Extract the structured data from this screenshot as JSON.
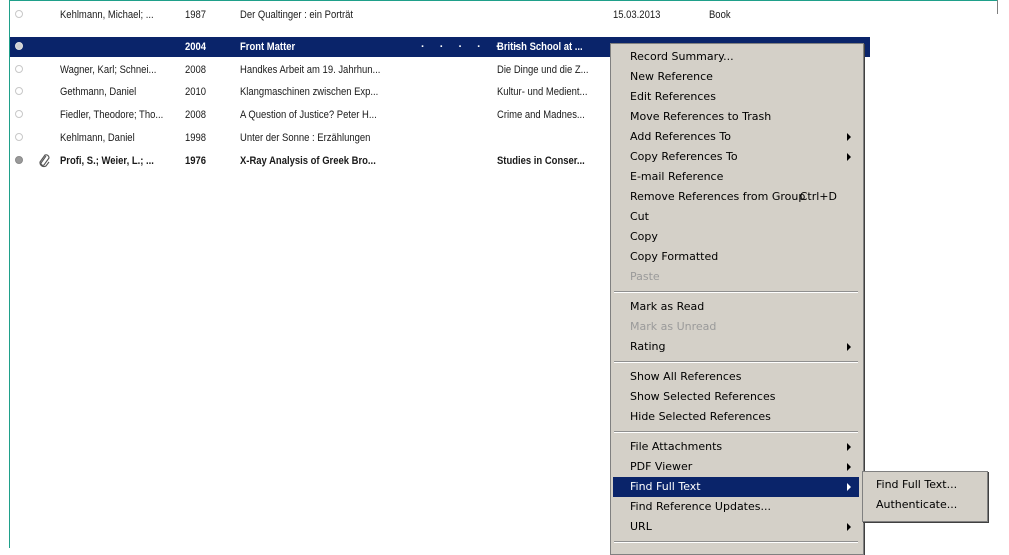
{
  "rows": [
    {
      "read": false,
      "attachment": false,
      "author": "Kehlmann, Michael; ...",
      "year": "1987",
      "title": "Der Qualtinger : ein Porträt",
      "secondary": "",
      "date": "15.03.2013",
      "type": "Book",
      "selected": false,
      "bold": false
    },
    {
      "read": true,
      "attachment": false,
      "author": "",
      "year": "2004",
      "title": "Front Matter",
      "secondary": "British School at ...",
      "date": "",
      "type": "",
      "selected": true,
      "bold": true
    },
    {
      "read": false,
      "attachment": false,
      "author": "Wagner, Karl; Schnei...",
      "year": "2008",
      "title": "Handkes Arbeit am 19. Jahrhun...",
      "secondary": "Die Dinge und die Z...",
      "date": "",
      "type": "",
      "selected": false,
      "bold": false
    },
    {
      "read": false,
      "attachment": false,
      "author": "Gethmann, Daniel",
      "year": "2010",
      "title": "Klangmaschinen zwischen Exp...",
      "secondary": "Kultur- und Medient...",
      "date": "",
      "type": "",
      "selected": false,
      "bold": false
    },
    {
      "read": false,
      "attachment": false,
      "author": "Fiedler, Theodore; Tho...",
      "year": "2008",
      "title": "A Question of Justice? Peter H...",
      "secondary": "Crime and Madnes...",
      "date": "",
      "type": "",
      "selected": false,
      "bold": false
    },
    {
      "read": false,
      "attachment": false,
      "author": "Kehlmann, Daniel",
      "year": "1998",
      "title": "Unter der Sonne : Erzählungen",
      "secondary": "",
      "date": "",
      "type": "",
      "selected": false,
      "bold": false
    },
    {
      "read": true,
      "attachment": true,
      "author": "Profi, S.; Weier, L.; ...",
      "year": "1976",
      "title": "X-Ray Analysis of Greek Bro...",
      "secondary": "Studies in Conser...",
      "date": "",
      "type": "",
      "selected": false,
      "bold": true
    }
  ],
  "selected_row_dots": "· · · · · ·",
  "context_menu": [
    {
      "label": "Record Summary...",
      "disabled": false,
      "submenu": false
    },
    {
      "label": "New Reference",
      "disabled": false,
      "submenu": false
    },
    {
      "label": "Edit References",
      "disabled": false,
      "submenu": false
    },
    {
      "label": "Move References to Trash",
      "disabled": false,
      "submenu": false
    },
    {
      "label": "Add References To",
      "disabled": false,
      "submenu": true
    },
    {
      "label": "Copy References To",
      "disabled": false,
      "submenu": true
    },
    {
      "label": "E-mail Reference",
      "disabled": false,
      "submenu": false
    },
    {
      "label": "Remove References from Group",
      "shortcut": "Ctrl+D",
      "disabled": false,
      "submenu": false
    },
    {
      "label": "Cut",
      "disabled": false,
      "submenu": false
    },
    {
      "label": "Copy",
      "disabled": false,
      "submenu": false
    },
    {
      "label": "Copy Formatted",
      "disabled": false,
      "submenu": false
    },
    {
      "label": "Paste",
      "disabled": true,
      "submenu": false
    },
    {
      "separator": true
    },
    {
      "label": "Mark as Read",
      "disabled": false,
      "submenu": false
    },
    {
      "label": "Mark as Unread",
      "disabled": true,
      "submenu": false
    },
    {
      "label": "Rating",
      "disabled": false,
      "submenu": true
    },
    {
      "separator": true
    },
    {
      "label": "Show All References",
      "disabled": false,
      "submenu": false
    },
    {
      "label": "Show Selected References",
      "disabled": false,
      "submenu": false
    },
    {
      "label": "Hide Selected References",
      "disabled": false,
      "submenu": false
    },
    {
      "separator": true
    },
    {
      "label": "File Attachments",
      "disabled": false,
      "submenu": true
    },
    {
      "label": "PDF Viewer",
      "disabled": false,
      "submenu": true
    },
    {
      "label": "Find Full Text",
      "disabled": false,
      "submenu": true,
      "highlighted": true
    },
    {
      "label": "Find Reference Updates...",
      "disabled": false,
      "submenu": false
    },
    {
      "label": "URL",
      "disabled": false,
      "submenu": true
    },
    {
      "separator": true
    }
  ],
  "find_full_text_submenu": [
    "Find Full Text...",
    "Authenticate..."
  ],
  "colors": {
    "selection": "#0a246a",
    "menu_bg": "#d4d0c8",
    "frame": "#1fa08a"
  }
}
